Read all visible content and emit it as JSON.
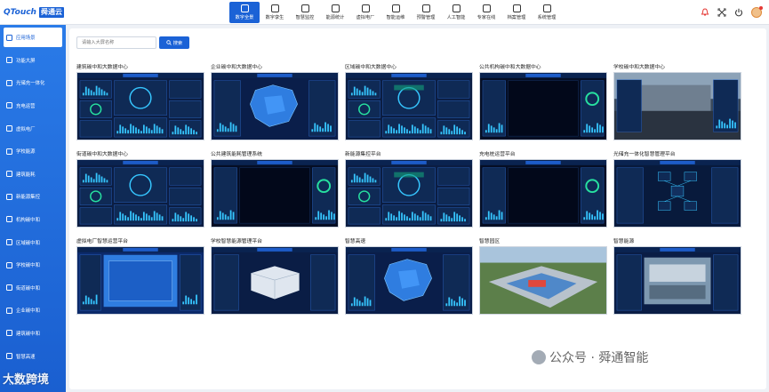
{
  "header": {
    "logo_latin": "QTouch",
    "logo_cn": "舜通云",
    "nav": [
      {
        "label": "数字全景",
        "icon": "grid-icon",
        "active": true
      },
      {
        "label": "数字孪生",
        "icon": "twin-icon",
        "active": false
      },
      {
        "label": "智慧监控",
        "icon": "chart-bar-icon",
        "active": false
      },
      {
        "label": "能源统计",
        "icon": "bolt-icon",
        "active": false
      },
      {
        "label": "虚拟电厂",
        "icon": "plant-icon",
        "active": false
      },
      {
        "label": "智能运维",
        "icon": "tool-icon",
        "active": false
      },
      {
        "label": "预警管理",
        "icon": "bell-icon",
        "active": false
      },
      {
        "label": "人工智能",
        "icon": "ai-icon",
        "active": false
      },
      {
        "label": "专家在线",
        "icon": "expert-icon",
        "active": false
      },
      {
        "label": "档案管理",
        "icon": "archive-icon",
        "active": false
      },
      {
        "label": "系统管理",
        "icon": "system-icon",
        "active": false
      }
    ],
    "right_icons": [
      "notification-icon",
      "fullscreen-icon",
      "power-icon"
    ]
  },
  "sidebar": {
    "items": [
      {
        "label": "应用场景",
        "active": true
      },
      {
        "label": "功能大屏",
        "active": false
      },
      {
        "label": "光储充一体化",
        "active": false
      },
      {
        "label": "充电运营",
        "active": false
      },
      {
        "label": "虚拟电厂",
        "active": false
      },
      {
        "label": "学校能源",
        "active": false
      },
      {
        "label": "建筑能耗",
        "active": false
      },
      {
        "label": "新能源集控",
        "active": false
      },
      {
        "label": "机构碳中和",
        "active": false
      },
      {
        "label": "区域碳中和",
        "active": false
      },
      {
        "label": "学校碳中和",
        "active": false
      },
      {
        "label": "街道碳中和",
        "active": false
      },
      {
        "label": "企业碳中和",
        "active": false
      },
      {
        "label": "建筑碳中和",
        "active": false
      },
      {
        "label": "智慧高速",
        "active": false
      }
    ],
    "version": "v3.0.2024"
  },
  "main": {
    "search_placeholder": "请输入大屏名称",
    "search_button": "搜索",
    "cards": [
      {
        "title": "建筑碳中和大数据中心",
        "style": "dash"
      },
      {
        "title": "企业碳中和大数据中心",
        "style": "map"
      },
      {
        "title": "区域碳中和大数据中心",
        "style": "dash2"
      },
      {
        "title": "公共机构碳中和大数据中心",
        "style": "dark"
      },
      {
        "title": "学校碳中和大数据中心",
        "style": "photo"
      },
      {
        "title": "街道碳中和大数据中心",
        "style": "dash"
      },
      {
        "title": "公共建筑能耗管理系统",
        "style": "dark"
      },
      {
        "title": "新能源集控平台",
        "style": "dash2"
      },
      {
        "title": "充电桩运营平台",
        "style": "dark"
      },
      {
        "title": "光储充一体化智慧管理平台",
        "style": "net"
      },
      {
        "title": "虚拟电厂智慧运营平台",
        "style": "blue"
      },
      {
        "title": "学校智慧能源管理平台",
        "style": "building"
      },
      {
        "title": "智慧高速",
        "style": "map"
      },
      {
        "title": "智慧园区",
        "style": "aerial"
      },
      {
        "title": "智慧能源",
        "style": "aerial2"
      }
    ]
  },
  "watermarks": {
    "left": "大数跨境",
    "right": "公众号 · 舜通智能"
  }
}
